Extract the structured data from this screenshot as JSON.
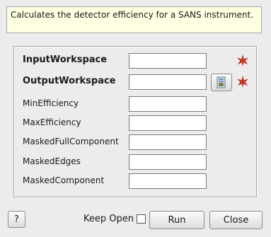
{
  "description": "Calculates the detector efficiency for a SANS instrument.",
  "fields": [
    {
      "label": "InputWorkspace",
      "value": "",
      "required": true,
      "bold": true,
      "browse": false
    },
    {
      "label": "OutputWorkspace",
      "value": "",
      "required": true,
      "bold": true,
      "browse": true
    },
    {
      "label": "MinEfficiency",
      "value": "",
      "required": false,
      "bold": false,
      "browse": false
    },
    {
      "label": "MaxEfficiency",
      "value": "",
      "required": false,
      "bold": false,
      "browse": false
    },
    {
      "label": "MaskedFullComponent",
      "value": "",
      "required": false,
      "bold": false,
      "browse": false
    },
    {
      "label": "MaskedEdges",
      "value": "",
      "required": false,
      "bold": false,
      "browse": false
    },
    {
      "label": "MaskedComponent",
      "value": "",
      "required": false,
      "bold": false,
      "browse": false
    }
  ],
  "footer": {
    "help_label": "?",
    "keep_open_label": "Keep Open",
    "keep_open_checked": false,
    "run_label": "Run",
    "close_label": "Close"
  },
  "colors": {
    "required_star": "#c0392b",
    "description_bg": "#ffffe1",
    "window_bg": "#ececec"
  },
  "icons": {
    "required": "required-star-icon",
    "browse": "workspace-browse-icon"
  }
}
